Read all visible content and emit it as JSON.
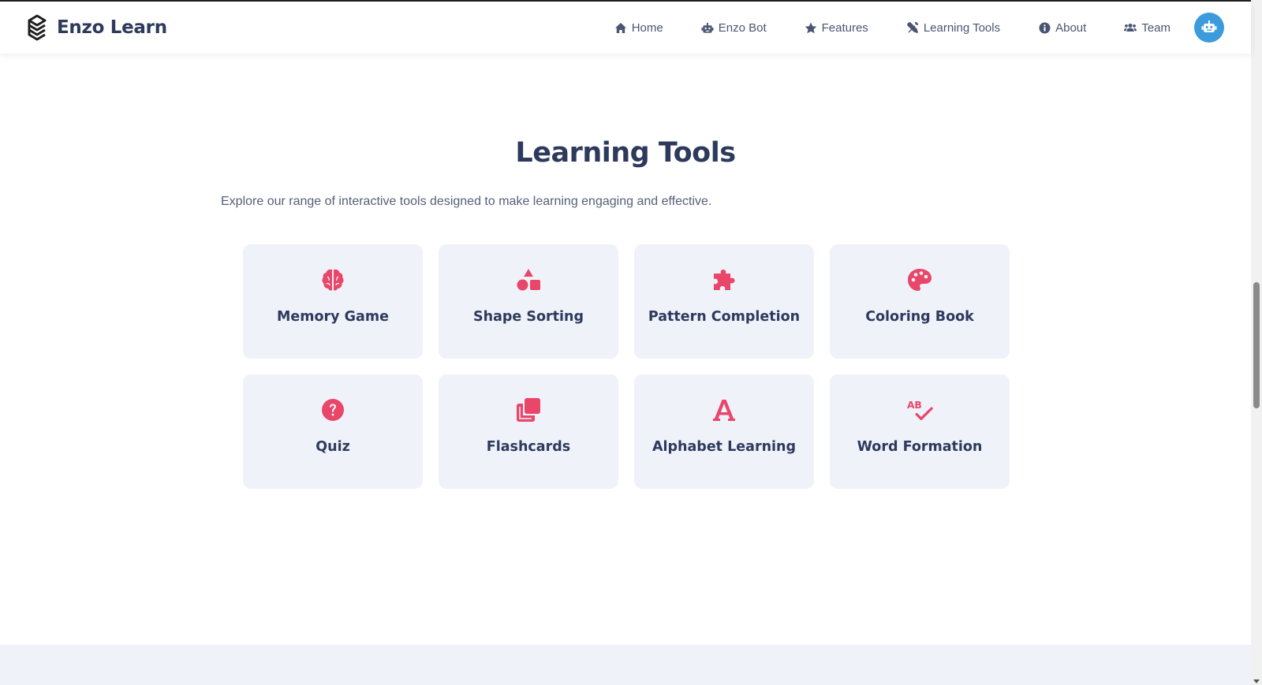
{
  "brand": {
    "name": "Enzo Learn",
    "logo_icon": "enzo-logo-icon"
  },
  "nav": {
    "items": [
      {
        "label": "Home",
        "icon": "home-icon"
      },
      {
        "label": "Enzo Bot",
        "icon": "robot-icon"
      },
      {
        "label": "Features",
        "icon": "star-icon"
      },
      {
        "label": "Learning Tools",
        "icon": "tools-icon"
      },
      {
        "label": "About",
        "icon": "info-icon"
      },
      {
        "label": "Team",
        "icon": "users-icon"
      }
    ],
    "bot_button_icon": "robot-icon"
  },
  "section": {
    "title": "Learning Tools",
    "description": "Explore our range of interactive tools designed to make learning engaging and effective.",
    "cards": [
      {
        "label": "Memory Game",
        "icon": "brain-icon"
      },
      {
        "label": "Shape Sorting",
        "icon": "shapes-icon"
      },
      {
        "label": "Pattern Completion",
        "icon": "puzzle-piece-icon"
      },
      {
        "label": "Coloring Book",
        "icon": "palette-icon"
      },
      {
        "label": "Quiz",
        "icon": "question-circle-icon"
      },
      {
        "label": "Flashcards",
        "icon": "clone-icon"
      },
      {
        "label": "Alphabet Learning",
        "icon": "letter-a-icon"
      },
      {
        "label": "Word Formation",
        "icon": "spell-check-icon"
      }
    ]
  },
  "colors": {
    "accent": "#e8476a",
    "text_dark": "#2d3a5c",
    "card_bg": "#f0f2fa",
    "bot_button": "#3b9bdb"
  }
}
